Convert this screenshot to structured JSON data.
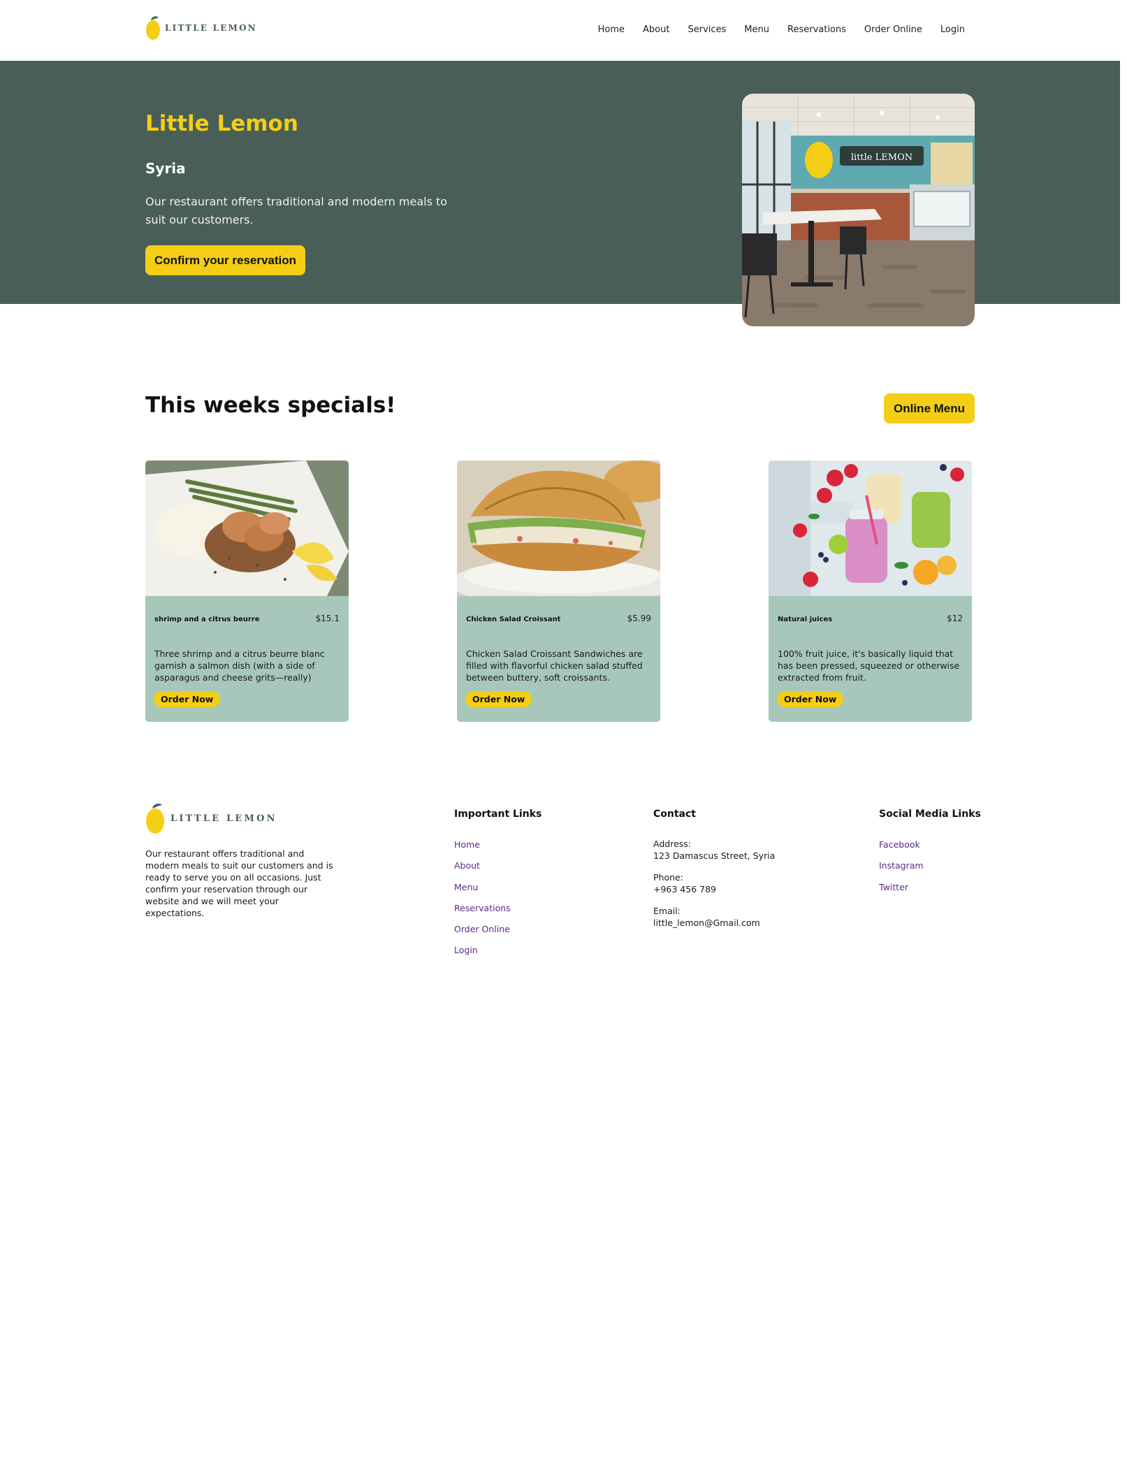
{
  "header": {
    "logo_text": "LITTLE LEMON",
    "nav": [
      "Home",
      "About",
      "Services",
      "Menu",
      "Reservations",
      "Order Online",
      "Login"
    ]
  },
  "hero": {
    "title": "Little Lemon",
    "city": "Syria",
    "description": "Our restaurant offers traditional and modern meals to suit our customers.",
    "button_label": "Confirm your reservation"
  },
  "specials": {
    "title": "This weeks specials!",
    "button_label": "Online Menu",
    "cards": [
      {
        "name": "shrimp and a citrus beurre",
        "price": "$15.1",
        "description": "Three shrimp and a citrus beurre blanc garnish a salmon dish (with a side of asparagus and cheese grits—really)",
        "button_label": "Order Now"
      },
      {
        "name": "Chicken Salad Croissant",
        "price": "$5.99",
        "description": "Chicken Salad Croissant Sandwiches are filled with flavorful chicken salad stuffed between buttery, soft croissants.",
        "button_label": "Order Now"
      },
      {
        "name": "Natural juices",
        "price": "$12",
        "description": "100% fruit juice, it's basically liquid that has been pressed, squeezed or otherwise extracted from fruit.",
        "button_label": "Order Now"
      }
    ]
  },
  "footer": {
    "logo_text": "LITTLE LEMON",
    "about": "Our restaurant offers traditional and modern meals to suit our customers and is ready to serve you on all occasions. Just confirm your reservation through our website and we will meet your expectations.",
    "important_links": {
      "title": "Important Links",
      "items": [
        "Home",
        "About",
        "Menu",
        "Reservations",
        "Order Online",
        "Login"
      ]
    },
    "contact": {
      "title": "Contact",
      "address_label": "Address:",
      "address": "123 Damascus Street, Syria",
      "phone_label": "Phone:",
      "phone": "+963 456 789",
      "email_label": "Email:",
      "email": "little_lemon@Gmail.com"
    },
    "social": {
      "title": "Social Media Links",
      "items": [
        "Facebook",
        "Instagram",
        "Twitter"
      ]
    }
  },
  "colors": {
    "primary_green": "#495e57",
    "primary_yellow": "#f4ce14",
    "card_bg": "#a7c7bb",
    "link_purple": "#5b2a86"
  },
  "icons": {
    "logo": "lemon-icon"
  }
}
